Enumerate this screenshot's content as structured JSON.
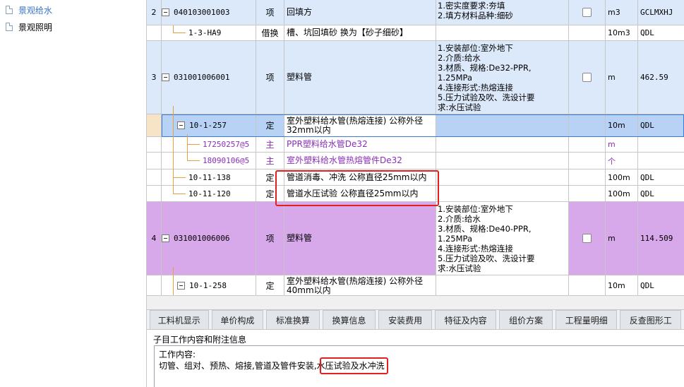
{
  "tree": {
    "items": [
      {
        "label": "景观给水",
        "selected": true
      },
      {
        "label": "景观照明",
        "selected": false
      }
    ]
  },
  "grid": {
    "rows": [
      {
        "num": "2",
        "code": "040103001003",
        "type": "项",
        "name": "回填方",
        "features": "1.密实度要求:夯填\n2.填方材料品种:细砂",
        "unit": "m3",
        "qty": "GCLMXHJ"
      },
      {
        "num": "",
        "code": "1-3-HA9",
        "type": "借换",
        "name": "槽、坑回填砂  换为【砂子细砂】",
        "features": "",
        "unit": "10m3",
        "qty": "QDL"
      },
      {
        "num": "3",
        "code": "031001006001",
        "type": "项",
        "name": "塑料管",
        "features": "1.安装部位:室外地下\n2.介质:给水\n3.材质、规格:De32-PPR,\n1.25MPa\n4.连接形式:热熔连接\n5.压力试验及吹、洗设计要\n求:水压试验",
        "unit": "m",
        "qty": "462.59"
      },
      {
        "num": "",
        "code": "10-1-257",
        "type": "定",
        "name": "室外塑料给水管(热熔连接) 公称外径32mm以内",
        "features": "",
        "unit": "10m",
        "qty": "QDL"
      },
      {
        "num": "",
        "code": "17250257@5",
        "type": "主",
        "name": "PPR塑料给水管De32",
        "features": "",
        "unit": "m",
        "qty": ""
      },
      {
        "num": "",
        "code": "18090106@5",
        "type": "主",
        "name": "室外塑料给水管热熔管件De32",
        "features": "",
        "unit": "个",
        "qty": ""
      },
      {
        "num": "",
        "code": "10-11-138",
        "type": "定",
        "name": "管道消毒、冲洗 公称直径25mm以内",
        "features": "",
        "unit": "100m",
        "qty": "QDL"
      },
      {
        "num": "",
        "code": "10-11-120",
        "type": "定",
        "name": "管道水压试验 公称直径25mm以内",
        "features": "",
        "unit": "100m",
        "qty": "QDL"
      },
      {
        "num": "4",
        "code": "031001006006",
        "type": "项",
        "name": "塑料管",
        "features": "1.安装部位:室外地下\n2.介质:给水\n3.材质、规格:De40-PPR,\n1.25MPa\n4.连接形式:热熔连接\n5.压力试验及吹、洗设计要\n求:水压试验",
        "unit": "m",
        "qty": "114.509"
      },
      {
        "num": "",
        "code": "10-1-258",
        "type": "定",
        "name": "室外塑料给水管(热熔连接) 公称外径40mm以内",
        "features": "",
        "unit": "10m",
        "qty": "QDL"
      }
    ]
  },
  "tabs": [
    "工料机显示",
    "单价构成",
    "标准换算",
    "换算信息",
    "安装费用",
    "特征及内容",
    "组价方案",
    "工程量明细",
    "反查图形工"
  ],
  "info": {
    "title": "子目工作内容和附注信息",
    "content_label": "工作内容:",
    "content": "切管、组对、预热、熔接,管道及管件安装,水压试验及水冲洗"
  },
  "colors": {
    "item_row": "#dce9fb",
    "purple_row": "#d7a8ea",
    "selected_row": "#b8d2f6",
    "material_text": "#8a2fb8",
    "highlight": "#e02020"
  }
}
